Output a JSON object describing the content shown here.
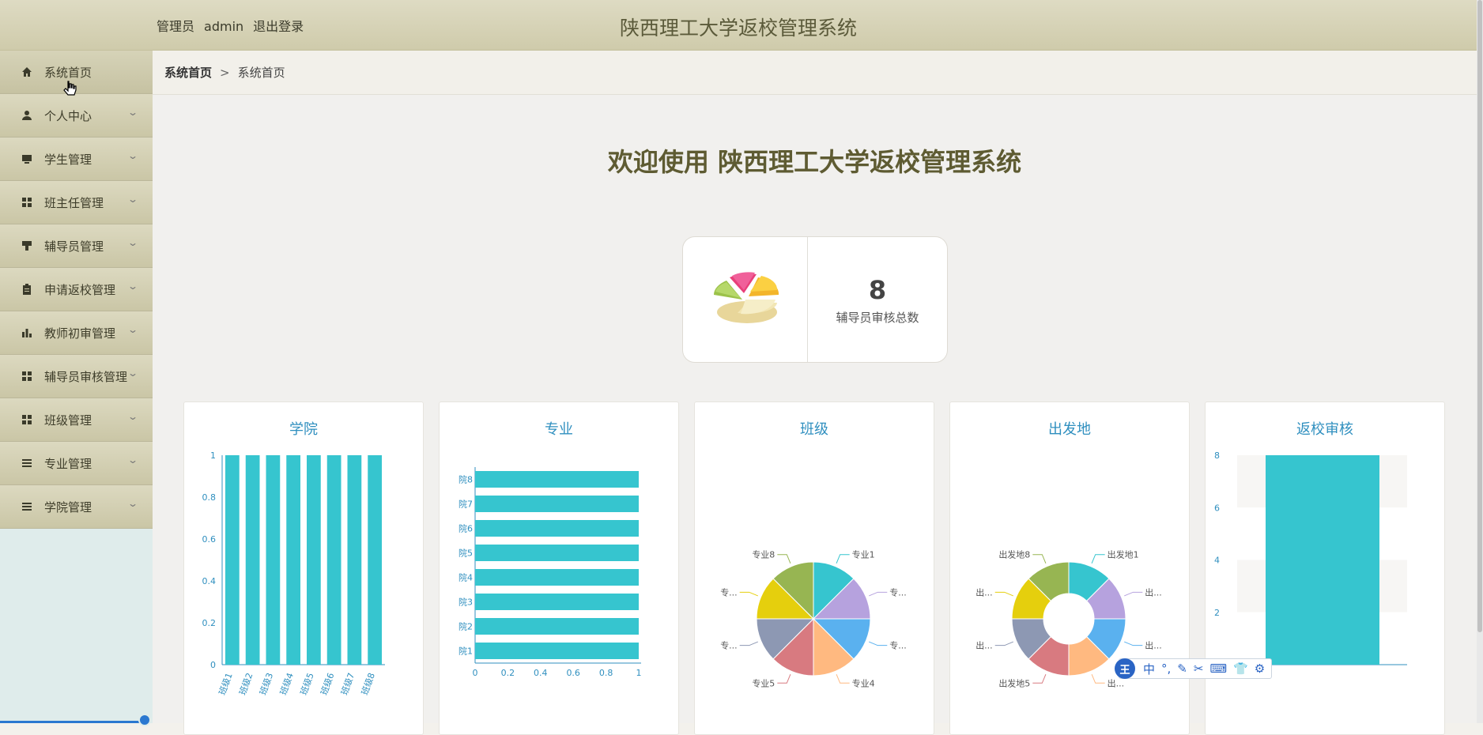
{
  "header": {
    "admin_role": "管理员",
    "admin_name": "admin",
    "logout": "退出登录",
    "title": "陕西理工大学返校管理系统"
  },
  "sidebar": {
    "items": [
      {
        "label": "系统首页",
        "icon": "home-icon",
        "active": true
      },
      {
        "label": "个人中心",
        "icon": "user-icon"
      },
      {
        "label": "学生管理",
        "icon": "monitor-icon"
      },
      {
        "label": "班主任管理",
        "icon": "grid-icon"
      },
      {
        "label": "辅导员管理",
        "icon": "stamp-icon"
      },
      {
        "label": "申请返校管理",
        "icon": "clipboard-icon"
      },
      {
        "label": "教师初审管理",
        "icon": "bar-chart-icon"
      },
      {
        "label": "辅导员审核管理",
        "icon": "grid-icon"
      },
      {
        "label": "班级管理",
        "icon": "grid-icon"
      },
      {
        "label": "专业管理",
        "icon": "list-icon"
      },
      {
        "label": "学院管理",
        "icon": "list-icon"
      }
    ]
  },
  "breadcrumb": {
    "home": "系统首页",
    "sep": ">",
    "current": "系统首页"
  },
  "welcome": "欢迎使用 陕西理工大学返校管理系统",
  "stat": {
    "value": "8",
    "label": "辅导员审核总数"
  },
  "ime": {
    "items": [
      "中",
      "°,",
      "✎",
      "✂",
      "⌨",
      "👕",
      "⚙"
    ],
    "logo": "王"
  },
  "colors": {
    "accent": "#36c5cf",
    "title": "#2f8fbf"
  },
  "chart_data": [
    {
      "type": "bar",
      "title": "学院",
      "categories": [
        "班级1",
        "班级2",
        "班级3",
        "班级4",
        "班级5",
        "班级6",
        "班级7",
        "班级8"
      ],
      "values": [
        1,
        1,
        1,
        1,
        1,
        1,
        1,
        1
      ],
      "ylim": [
        0,
        1
      ],
      "yticks": [
        "0",
        "0.2",
        "0.4",
        "0.6",
        "0.8",
        "1"
      ]
    },
    {
      "type": "bar",
      "orientation": "horizontal",
      "title": "专业",
      "categories": [
        "院1",
        "院2",
        "院3",
        "院4",
        "院5",
        "院6",
        "院7",
        "院8"
      ],
      "values": [
        1,
        1,
        1,
        1,
        1,
        1,
        1,
        1
      ],
      "xlim": [
        0,
        1
      ],
      "xticks": [
        "0",
        "0.2",
        "0.4",
        "0.6",
        "0.8",
        "1"
      ]
    },
    {
      "type": "pie",
      "title": "班级",
      "labels": [
        "专业1",
        "专...",
        "专...",
        "专业4",
        "专业5",
        "专...",
        "专...",
        "专业8"
      ],
      "values": [
        1,
        1,
        1,
        1,
        1,
        1,
        1,
        1
      ],
      "colors": [
        "#36c5cf",
        "#b6a2de",
        "#5ab1ef",
        "#ffb980",
        "#d87a80",
        "#8d98b3",
        "#e5cf0d",
        "#97b552"
      ]
    },
    {
      "type": "pie",
      "donut": true,
      "title": "出发地",
      "labels": [
        "出发地1",
        "出...",
        "出...",
        "出...",
        "出发地5",
        "出...",
        "出...",
        "出发地8"
      ],
      "values": [
        1,
        1,
        1,
        1,
        1,
        1,
        1,
        1
      ],
      "colors": [
        "#36c5cf",
        "#b6a2de",
        "#5ab1ef",
        "#ffb980",
        "#d87a80",
        "#8d98b3",
        "#e5cf0d",
        "#97b552"
      ]
    },
    {
      "type": "bar",
      "title": "返校审核",
      "categories": [
        ""
      ],
      "values": [
        8
      ],
      "ylim": [
        0,
        8
      ],
      "yticks": [
        "2",
        "4",
        "6",
        "8"
      ]
    }
  ]
}
